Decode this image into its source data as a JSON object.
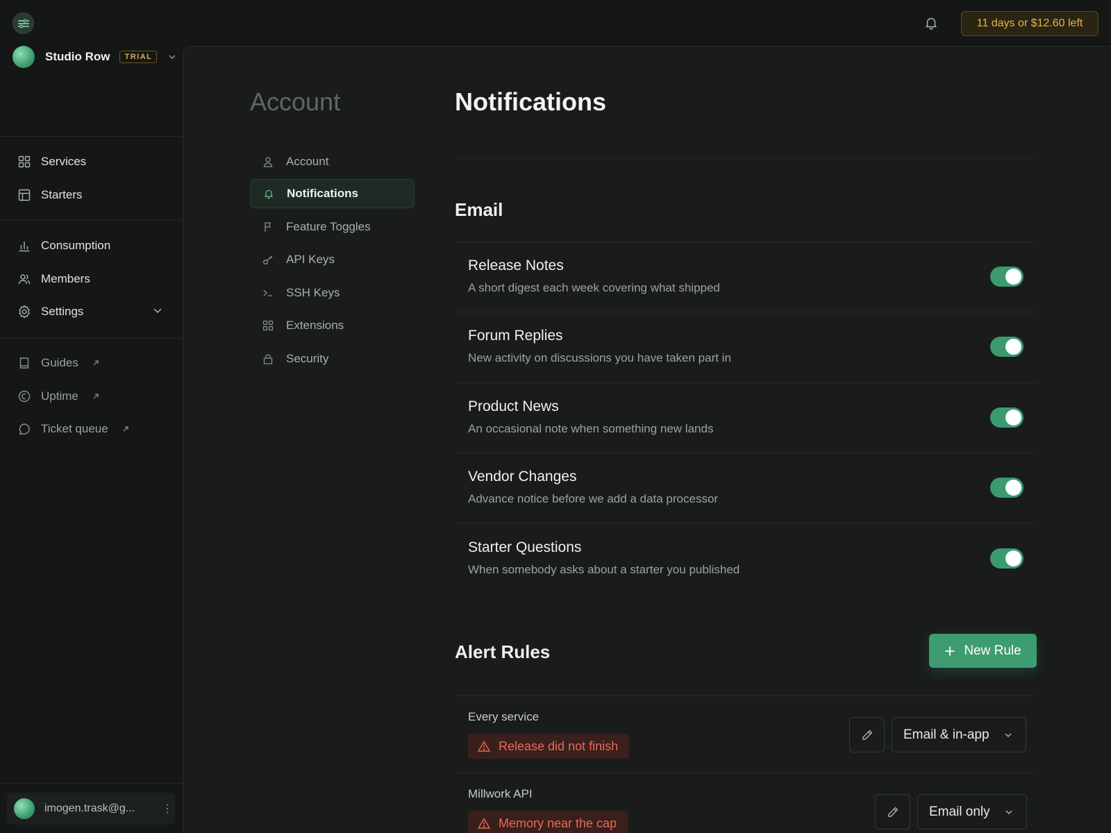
{
  "topbar": {
    "menu_icon": "menu-icon",
    "bell_icon": "bell-icon",
    "trial_remaining": "11 days or $12.60 left"
  },
  "sidebar": {
    "org_name": "Studio Row",
    "org_badge": "TRIAL",
    "primary": [
      {
        "label": "Services",
        "icon": "grid-icon"
      },
      {
        "label": "Starters",
        "icon": "layout-icon"
      }
    ],
    "secondary": [
      {
        "label": "Consumption",
        "icon": "bar-chart-icon"
      },
      {
        "label": "Members",
        "icon": "users-icon"
      },
      {
        "label": "Settings",
        "icon": "gear-icon"
      }
    ],
    "external": [
      {
        "label": "Guides",
        "icon": "book-icon"
      },
      {
        "label": "Uptime",
        "icon": "status-icon"
      },
      {
        "label": "Ticket queue",
        "icon": "chat-icon"
      }
    ],
    "user_email": "imogen.trask@g..."
  },
  "subnav": {
    "title": "Account",
    "items": [
      {
        "label": "Account",
        "icon": "user-icon"
      },
      {
        "label": "Notifications",
        "icon": "bell-icon",
        "active": true
      },
      {
        "label": "Feature Toggles",
        "icon": "flag-icon"
      },
      {
        "label": "API Keys",
        "icon": "key-icon"
      },
      {
        "label": "SSH Keys",
        "icon": "terminal-icon"
      },
      {
        "label": "Extensions",
        "icon": "grid-icon"
      },
      {
        "label": "Security",
        "icon": "lock-icon"
      }
    ]
  },
  "main": {
    "page_title": "Notifications",
    "email_section": {
      "title": "Email",
      "items": [
        {
          "title": "Release Notes",
          "description": "A short digest each week covering what shipped",
          "enabled": true
        },
        {
          "title": "Forum Replies",
          "description": "New activity on discussions you have taken part in",
          "enabled": true
        },
        {
          "title": "Product News",
          "description": "An occasional note when something new lands",
          "enabled": true
        },
        {
          "title": "Vendor Changes",
          "description": "Advance notice before we add a data processor",
          "enabled": true
        },
        {
          "title": "Starter Questions",
          "description": "When somebody asks about a starter you published",
          "enabled": true
        }
      ]
    },
    "alert_rules": {
      "title": "Alert Rules",
      "new_rule_label": "New Rule",
      "rules": [
        {
          "scope": "Every service",
          "trigger": "Release did not finish",
          "channel": "Email & in-app"
        },
        {
          "scope": "Millwork API",
          "trigger": "Memory near the cap",
          "channel": "Email only"
        }
      ]
    }
  },
  "colors": {
    "accent": "#3d9c72",
    "warning": "#e3b549",
    "danger": "#e36b56",
    "background": "#141716"
  }
}
